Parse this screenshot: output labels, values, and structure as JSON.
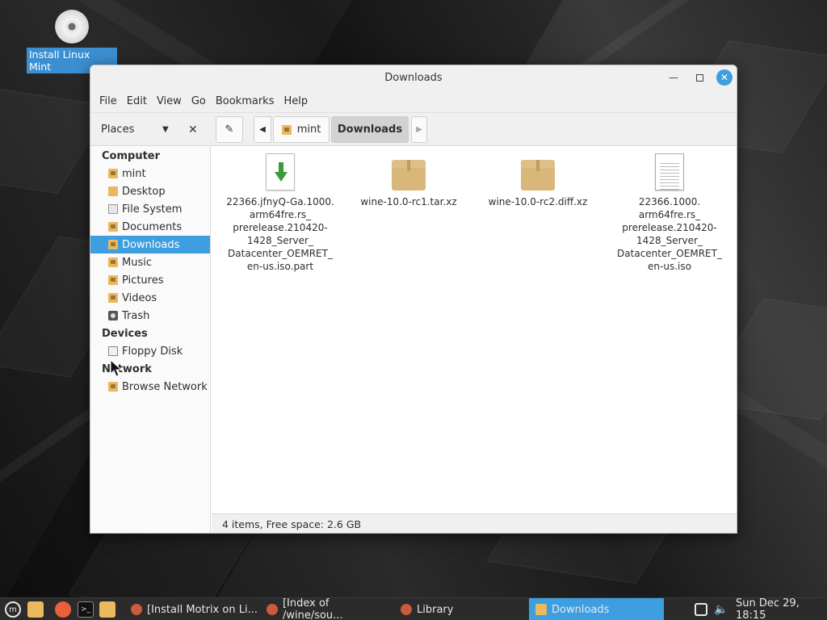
{
  "desktop": {
    "icon_label": "Install Linux Mint"
  },
  "window": {
    "title": "Downloads",
    "menu": [
      "File",
      "Edit",
      "View",
      "Go",
      "Bookmarks",
      "Help"
    ],
    "places_label": "Places",
    "breadcrumbs": [
      "mint",
      "Downloads"
    ],
    "sidebar": {
      "sections": [
        {
          "title": "Computer",
          "items": [
            {
              "label": "mint",
              "icon": "home-folder-icon"
            },
            {
              "label": "Desktop",
              "icon": "folder-icon"
            },
            {
              "label": "File System",
              "icon": "drive-icon"
            },
            {
              "label": "Documents",
              "icon": "documents-folder-icon"
            },
            {
              "label": "Downloads",
              "icon": "downloads-folder-icon",
              "selected": true
            },
            {
              "label": "Music",
              "icon": "music-folder-icon"
            },
            {
              "label": "Pictures",
              "icon": "pictures-folder-icon"
            },
            {
              "label": "Videos",
              "icon": "videos-folder-icon"
            },
            {
              "label": "Trash",
              "icon": "trash-icon"
            }
          ]
        },
        {
          "title": "Devices",
          "items": [
            {
              "label": "Floppy Disk",
              "icon": "floppy-icon"
            }
          ]
        },
        {
          "title": "Network",
          "items": [
            {
              "label": "Browse Network",
              "icon": "network-folder-icon"
            }
          ]
        }
      ]
    },
    "files": [
      {
        "name": "22366.jfnyQ-Ga.1000.\narm64fre.rs_\nprerelease.210420-\n1428_Server_\nDatacenter_OEMRET_\nen-us.iso.part",
        "icon": "download-file-icon"
      },
      {
        "name": "wine-10.0-rc1.tar.xz",
        "icon": "archive-icon"
      },
      {
        "name": "wine-10.0-rc2.diff.xz",
        "icon": "archive-icon"
      },
      {
        "name": "22366.1000.\narm64fre.rs_\nprerelease.210420-\n1428_Server_\nDatacenter_OEMRET_\nen-us.iso",
        "icon": "document-icon"
      }
    ],
    "status": "4 items, Free space: 2.6 GB"
  },
  "taskbar": {
    "windows": [
      {
        "label": "[Install Motrix on Li...",
        "active": false
      },
      {
        "label": "[Index of /wine/sou...",
        "active": false
      },
      {
        "label": "Library",
        "active": false
      },
      {
        "label": "Downloads",
        "active": true
      }
    ],
    "clock": "Sun Dec 29, 18:15"
  },
  "colors": {
    "accent": "#3d9ee0",
    "folder": "#e9b85f"
  }
}
